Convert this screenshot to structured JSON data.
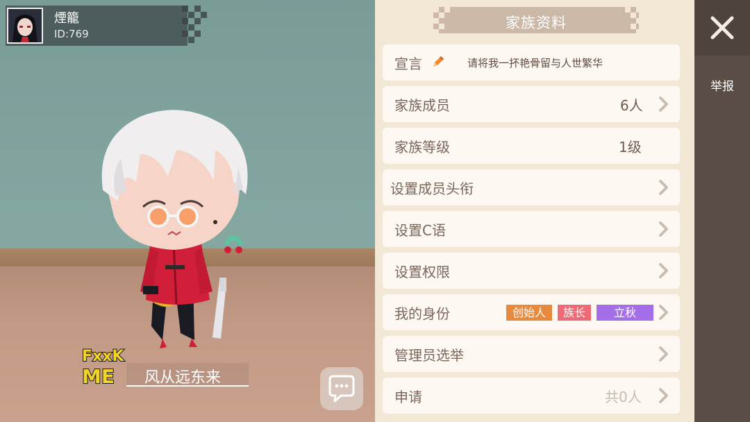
{
  "player": {
    "name": "煙籠",
    "id": "ID:769"
  },
  "scene": {
    "badge_text": [
      "FxxK",
      "ME"
    ],
    "nameplate": "风从远东来"
  },
  "panel": {
    "title": "家族资料",
    "rows": [
      {
        "label": "宣言",
        "value": "请将我一抔艳骨留与人世繁华"
      },
      {
        "label": "家族成员",
        "value": "6人"
      },
      {
        "label": "家族等级",
        "value": "1级"
      },
      {
        "label": "设置成员头衔",
        "value": ""
      },
      {
        "label": "设置C语",
        "value": ""
      },
      {
        "label": "设置权限",
        "value": ""
      },
      {
        "label": "我的身份",
        "value": ""
      },
      {
        "label": "管理员选举",
        "value": ""
      },
      {
        "label": "申请",
        "value": "共0人"
      }
    ],
    "identity_tags": [
      {
        "text": "创始人",
        "color": "#e88a3d"
      },
      {
        "text": "族长",
        "color": "#ec6b77"
      },
      {
        "text": "立秋",
        "color": "#a46ee8"
      }
    ]
  },
  "rail": {
    "report_label": "举报"
  },
  "icons": {
    "close": "close-icon",
    "chat": "chat-bubble-icon",
    "pencil": "pencil-icon",
    "arrow": "chevron-right-icon"
  },
  "colors": {
    "panel_bg": "#f3e8d6",
    "row_bg": "#fdf9f2",
    "header_bg": "#cbb8a6",
    "rail_bg": "#5a4d46",
    "label_text": "#7a665c"
  }
}
